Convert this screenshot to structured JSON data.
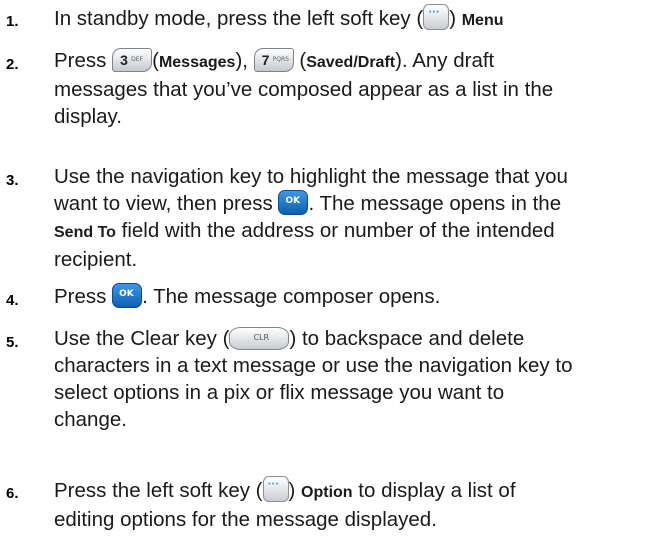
{
  "steps": [
    {
      "num": "1.",
      "lines": [
        [
          "In standby mode, press the left soft key (",
          "soft-key",
          ") ",
          "b:Menu"
        ]
      ]
    },
    {
      "num": "2.",
      "lines": [
        [
          "Press ",
          "key3",
          "(",
          "b:Messages",
          "), ",
          "key7",
          " (",
          "b:Saved/Draft",
          "). Any draft"
        ],
        [
          "messages that you’ve composed appear as a list in the"
        ],
        [
          "display."
        ]
      ]
    },
    {
      "num": "3.",
      "lines": [
        [
          "Use the navigation key to highlight the message that you"
        ],
        [
          "want to view, then press ",
          "ok-key",
          ". The message opens in the"
        ],
        [
          "b:Send To",
          " field with the address or number of the intended"
        ],
        [
          "recipient."
        ]
      ]
    },
    {
      "num": "4.",
      "lines": [
        [
          "Press ",
          "ok-key",
          ". The message composer opens."
        ]
      ]
    },
    {
      "num": "5.",
      "lines": [
        [
          "Use the Clear key (",
          "clr-key",
          ") to backspace and delete"
        ],
        [
          "characters in a text message or use the navigation key to"
        ],
        [
          "select options in a pix or flix message you want to"
        ],
        [
          "change."
        ]
      ]
    },
    {
      "num": "6.",
      "lines": [
        [
          "Press the left soft key (",
          "soft-key",
          ") ",
          "b:Option",
          " to display a list of"
        ],
        [
          "editing options for the message displayed."
        ]
      ]
    }
  ],
  "icons": {
    "key3": {
      "label": "3",
      "sub": "DEF"
    },
    "key7": {
      "label": "7",
      "sub": "PQRS"
    },
    "ok": {
      "label": "OK"
    },
    "clr": {
      "label": "CLR"
    }
  }
}
